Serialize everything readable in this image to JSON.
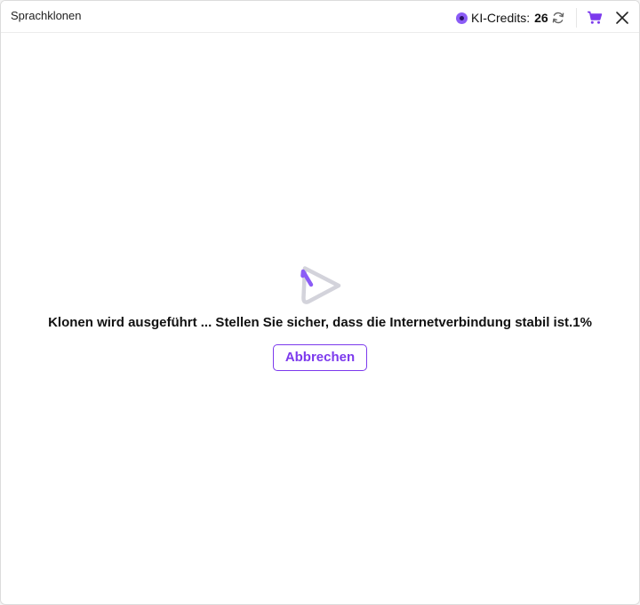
{
  "window": {
    "title": "Sprachklonen"
  },
  "header": {
    "credits_label": "KI-Credits:",
    "credits_value": "26",
    "icons": [
      "credits-coin-icon",
      "refresh-icon",
      "cart-icon",
      "close-icon"
    ]
  },
  "main": {
    "status_text": "Klonen wird ausgeführt ... Stellen Sie sicher, dass die Internetverbindung stabil ist.1%",
    "progress_percent": 1,
    "cancel_label": "Abbrechen"
  },
  "colors": {
    "accent": "#7c3aed",
    "spinner_track": "#d3d3db",
    "background": "#ffffff"
  }
}
